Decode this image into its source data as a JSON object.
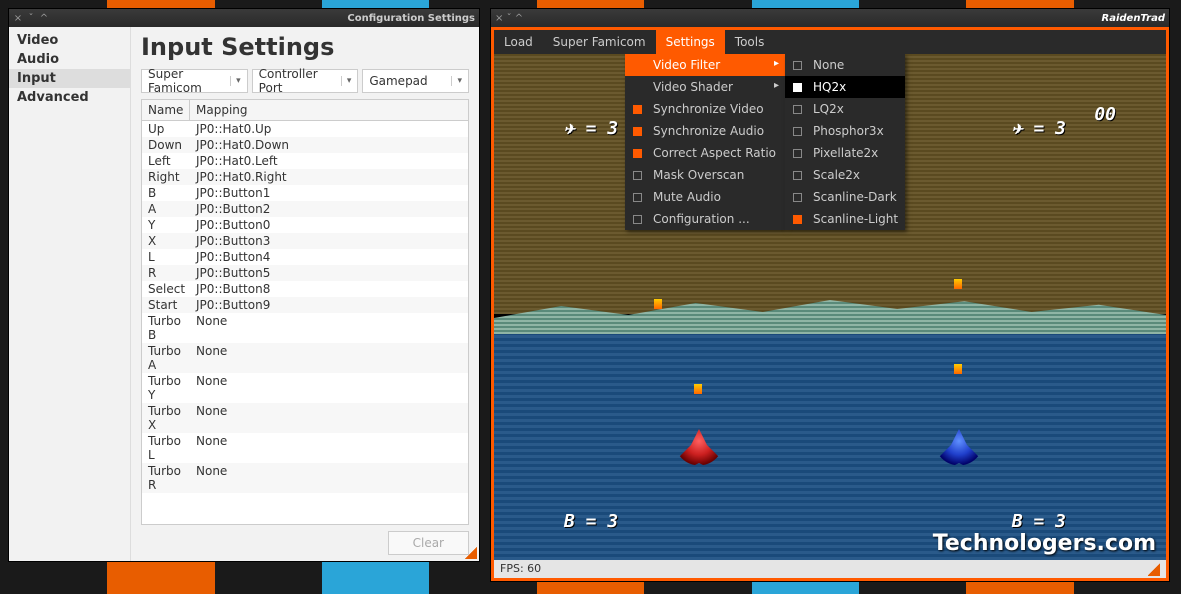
{
  "bg_colors": [
    "#1a1a1a",
    "#e85d00",
    "#1a1a1a",
    "#2aa5d8",
    "#1a1a1a",
    "#e85d00",
    "#1a1a1a",
    "#2aa5d8",
    "#1a1a1a",
    "#e85d00",
    "#1a1a1a"
  ],
  "config_window": {
    "title": "Configuration Settings",
    "sidebar": [
      {
        "label": "Video",
        "active": false
      },
      {
        "label": "Audio",
        "active": false
      },
      {
        "label": "Input",
        "active": true
      },
      {
        "label": "Advanced",
        "active": false
      }
    ],
    "heading": "Input Settings",
    "selectors": [
      "Super Famicom",
      "Controller Port",
      "Gamepad"
    ],
    "columns": [
      "Name",
      "Mapping"
    ],
    "rows": [
      {
        "name": "Up",
        "map": "JP0::Hat0.Up"
      },
      {
        "name": "Down",
        "map": "JP0::Hat0.Down"
      },
      {
        "name": "Left",
        "map": "JP0::Hat0.Left"
      },
      {
        "name": "Right",
        "map": "JP0::Hat0.Right"
      },
      {
        "name": "B",
        "map": "JP0::Button1"
      },
      {
        "name": "A",
        "map": "JP0::Button2"
      },
      {
        "name": "Y",
        "map": "JP0::Button0"
      },
      {
        "name": "X",
        "map": "JP0::Button3"
      },
      {
        "name": "L",
        "map": "JP0::Button4"
      },
      {
        "name": "R",
        "map": "JP0::Button5"
      },
      {
        "name": "Select",
        "map": "JP0::Button8"
      },
      {
        "name": "Start",
        "map": "JP0::Button9"
      },
      {
        "name": "Turbo B",
        "map": "None"
      },
      {
        "name": "Turbo A",
        "map": "None"
      },
      {
        "name": "Turbo Y",
        "map": "None"
      },
      {
        "name": "Turbo X",
        "map": "None"
      },
      {
        "name": "Turbo L",
        "map": "None"
      },
      {
        "name": "Turbo R",
        "map": "None"
      }
    ],
    "clear_label": "Clear"
  },
  "emu_window": {
    "title": "RaidenTrad",
    "menubar": [
      {
        "label": "Load",
        "active": false
      },
      {
        "label": "Super Famicom",
        "active": false
      },
      {
        "label": "Settings",
        "active": true
      },
      {
        "label": "Tools",
        "active": false
      }
    ],
    "settings_menu": [
      {
        "label": "Video Filter",
        "checked": false,
        "submenu": true,
        "highlight": true
      },
      {
        "label": "Video Shader",
        "checked": false,
        "submenu": true
      },
      {
        "label": "Synchronize Video",
        "checked": true
      },
      {
        "label": "Synchronize Audio",
        "checked": true
      },
      {
        "label": "Correct Aspect Ratio",
        "checked": true
      },
      {
        "label": "Mask Overscan",
        "checked": false
      },
      {
        "label": "Mute Audio",
        "checked": false
      },
      {
        "label": "Configuration ...",
        "checked": false
      }
    ],
    "filter_submenu": [
      {
        "label": "None",
        "checked": false
      },
      {
        "label": "HQ2x",
        "checked": true,
        "selected": true
      },
      {
        "label": "LQ2x",
        "checked": false
      },
      {
        "label": "Phosphor3x",
        "checked": false
      },
      {
        "label": "Pixellate2x",
        "checked": false
      },
      {
        "label": "Scale2x",
        "checked": false
      },
      {
        "label": "Scanline-Dark",
        "checked": false
      },
      {
        "label": "Scanline-Light",
        "checked": true
      }
    ],
    "hud": {
      "p1_lives": "✈ = 3",
      "p2_lives": "✈ = 3",
      "p1_bombs": "B = 3",
      "p2_bombs": "B = 3",
      "score": "00"
    },
    "status": "FPS: 60",
    "watermark": "Technologers.com"
  }
}
